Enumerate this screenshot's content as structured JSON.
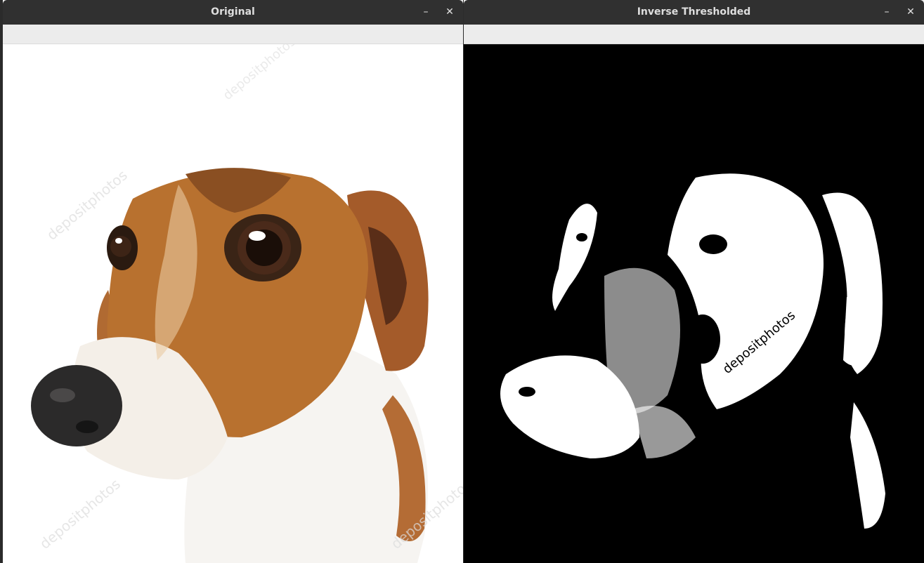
{
  "windows": [
    {
      "title": "Original",
      "buttons": {
        "minimize": "–",
        "close": "✕"
      },
      "image": {
        "subject": "dog-photo",
        "watermark": "depositphotos"
      }
    },
    {
      "title": "Inverse Thresholded",
      "buttons": {
        "minimize": "–",
        "close": "✕"
      },
      "image": {
        "subject": "dog-thresholded-inverse",
        "watermark": "depositphotos"
      }
    }
  ],
  "colors": {
    "titlebar": "#303030",
    "title_text": "#dedede",
    "toolbar": "#ececec",
    "fur_brown": "#b06a32",
    "fur_white": "#f7f5f2",
    "nose": "#2a2a2a"
  }
}
